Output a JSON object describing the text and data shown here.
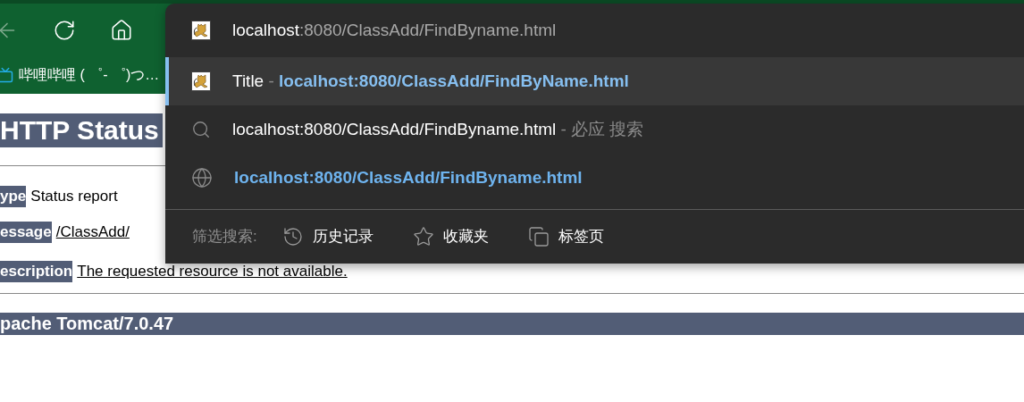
{
  "toolbar": {
    "buttons": [
      {
        "kind": "back",
        "disabled": true
      },
      {
        "kind": "refresh",
        "disabled": false
      },
      {
        "kind": "home",
        "disabled": false
      }
    ]
  },
  "bookmarks": [
    {
      "label": "哔哩哔哩 ( ゜- ゜)つ…"
    }
  ],
  "page": {
    "heading": "HTTP Status",
    "fields": [
      {
        "label": "ype",
        "value": "Status report",
        "link": false
      },
      {
        "label": "essage",
        "value": "/ClassAdd/",
        "link": true
      },
      {
        "label": "escription",
        "value": "The requested resource is not available.",
        "link": true
      }
    ],
    "footer": "pache Tomcat/7.0.47"
  },
  "dropdown": {
    "input": {
      "typed": "localhost",
      "completion": ":8080/ClassAdd/FindByname.html"
    },
    "suggestions": [
      {
        "kind": "page",
        "title": "Title",
        "separator": "-",
        "url": "localhost:8080/ClassAdd/FindByName.html",
        "selected": true
      },
      {
        "kind": "search",
        "query": "localhost:8080/ClassAdd/FindByname.html",
        "separator": "-",
        "engine": "必应 搜索",
        "selected": false
      },
      {
        "kind": "url",
        "url": "localhost:8080/ClassAdd/FindByname.html",
        "selected": false
      }
    ],
    "filter": {
      "label": "筛选搜索:",
      "options": [
        {
          "kind": "history",
          "label": "历史记录"
        },
        {
          "kind": "favorites",
          "label": "收藏夹"
        },
        {
          "kind": "tabs",
          "label": "标签页"
        }
      ]
    }
  }
}
